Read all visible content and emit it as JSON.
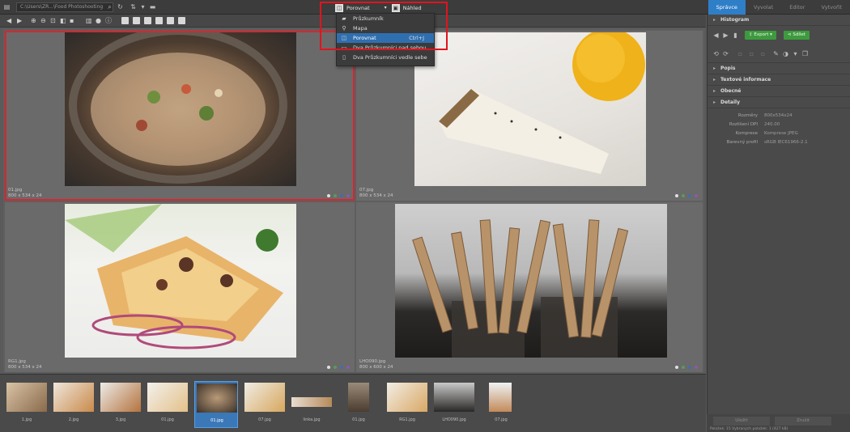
{
  "topbar": {
    "path": "C:\\Users\\ZR...\\Food Photoshooting",
    "mode_label": "Porovnat",
    "preview_label": "Náhled"
  },
  "tabs": [
    {
      "label": "Správce",
      "active": true
    },
    {
      "label": "Vyvolat",
      "active": false
    },
    {
      "label": "Editor",
      "active": false
    },
    {
      "label": "Vytvořit",
      "active": false
    }
  ],
  "menu": {
    "items": [
      {
        "label": "Průzkumník",
        "shortcut": "",
        "icon": "folder-icon",
        "highlighted": false
      },
      {
        "label": "Mapa",
        "shortcut": "",
        "icon": "map-pin-icon",
        "highlighted": false
      },
      {
        "label": "Porovnat",
        "shortcut": "Ctrl+J",
        "icon": "compare-icon",
        "highlighted": true
      },
      {
        "label": "Dva Průzkumníci nad sebou",
        "shortcut": "",
        "icon": "split-horizontal-icon",
        "highlighted": false
      },
      {
        "label": "Dva Průzkumníci vedle sebe",
        "shortcut": "",
        "icon": "split-vertical-icon",
        "highlighted": false
      }
    ]
  },
  "compare": {
    "panes": [
      {
        "name": "01.jpg",
        "dims": "800 x 534 x 24",
        "selected": true
      },
      {
        "name": "07.jpg",
        "dims": "800 x 534 x 24",
        "selected": false
      },
      {
        "name": "RG1.jpg",
        "dims": "800 x 534 x 24",
        "selected": false
      },
      {
        "name": "LHO090.jpg",
        "dims": "800 x 600 x 24",
        "selected": false
      }
    ]
  },
  "panel": {
    "histogram": "Histogram",
    "export_label": "Export",
    "share_label": "Sdílet",
    "sections": [
      "Popis",
      "Textové informace",
      "Obecné",
      "Detaily"
    ],
    "properties": [
      {
        "k": "Rozměry",
        "v": "800x534x24"
      },
      {
        "k": "Rozlišení DPI",
        "v": "240.00"
      },
      {
        "k": "Komprese",
        "v": "Komprese JPEG"
      },
      {
        "k": "Barevný profil",
        "v": "sRGB IEC61966-2.1"
      }
    ],
    "bottom_buttons": [
      "Uložit",
      "Zrušit"
    ],
    "status": "Položek: 15   Vybraných položek: 1 (427 kB)"
  },
  "filmstrip": [
    {
      "label": "1.jpg"
    },
    {
      "label": "2.jpg"
    },
    {
      "label": "3.jpg"
    },
    {
      "label": "01.jpg"
    },
    {
      "label": "01.jpg"
    },
    {
      "label": "07.jpg"
    },
    {
      "label": "linka.jpg"
    },
    {
      "label": "01.jpg"
    },
    {
      "label": "RG1.jpg"
    },
    {
      "label": "LHO090.jpg"
    },
    {
      "label": "07.jpg"
    }
  ],
  "colors": {
    "accent": "#2f7ec8",
    "selection": "#d7262f",
    "highlight_box": "#e0141e",
    "green_button": "#3e9a3e"
  }
}
